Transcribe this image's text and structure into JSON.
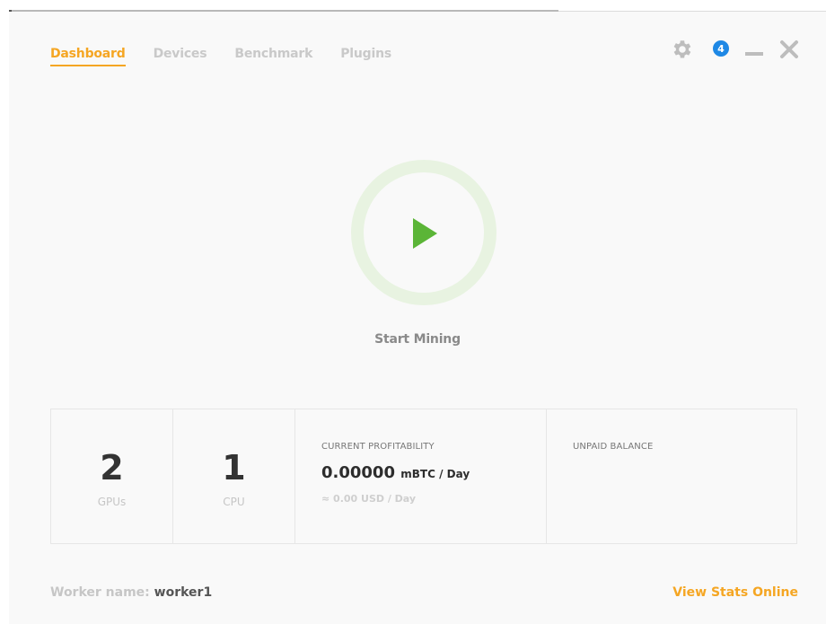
{
  "tabs": [
    {
      "label": "Dashboard",
      "active": true
    },
    {
      "label": "Devices",
      "active": false
    },
    {
      "label": "Benchmark",
      "active": false
    },
    {
      "label": "Plugins",
      "active": false
    }
  ],
  "header": {
    "notifications_count": "4",
    "icons": [
      "gear-icon",
      "notification-badge",
      "minimize-icon",
      "close-icon"
    ]
  },
  "start": {
    "label": "Start Mining",
    "icon": "play-icon"
  },
  "stats": {
    "gpus_value": "2",
    "gpus_label": "GPUs",
    "cpu_value": "1",
    "cpu_label": "CPU",
    "profitability_caption": "CURRENT PROFITABILITY",
    "profitability_value": "0.00000",
    "profitability_unit": "mBTC / Day",
    "profitability_usd": "≈ 0.00 USD / Day",
    "balance_caption": "UNPAID BALANCE"
  },
  "footer": {
    "worker_label": "Worker name:",
    "worker_value": "worker1",
    "view_stats": "View Stats Online"
  },
  "colors": {
    "accent": "#f5a623",
    "play": "#5bb537",
    "ring": "#e8f3e1",
    "badge": "#1e88e5"
  }
}
